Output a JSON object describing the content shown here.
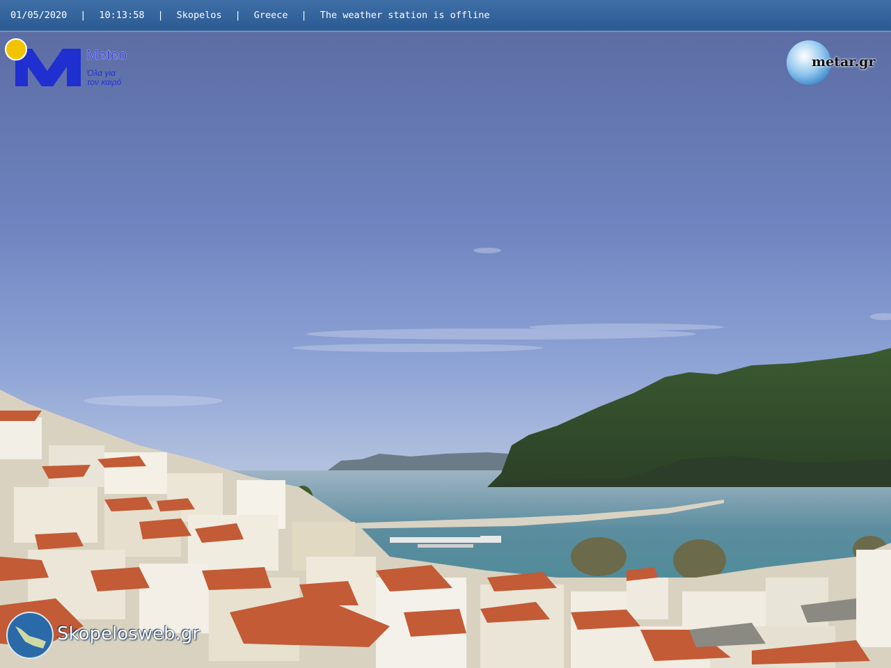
{
  "status_bar": {
    "date": "01/05/2020",
    "separator": "|",
    "time": "10:13:58",
    "location": "Skopelos",
    "country": "Greece",
    "status": "The weather station is offline"
  },
  "logos": {
    "meteo": {
      "title": "Meteo",
      "tagline_line1": "Όλα για",
      "tagline_line2": "τον καιρό"
    },
    "metar": {
      "text": "metar.gr"
    },
    "skopelosweb": {
      "text": "Skopelosweb.gr"
    }
  },
  "colors": {
    "status_bar": "#2f5e97",
    "meteo_blue": "#1f2fd0",
    "meteo_sun": "#f2c400",
    "sea": "#4f8f9b",
    "roof": "#c7603a",
    "mountain": "#3e5a33"
  }
}
